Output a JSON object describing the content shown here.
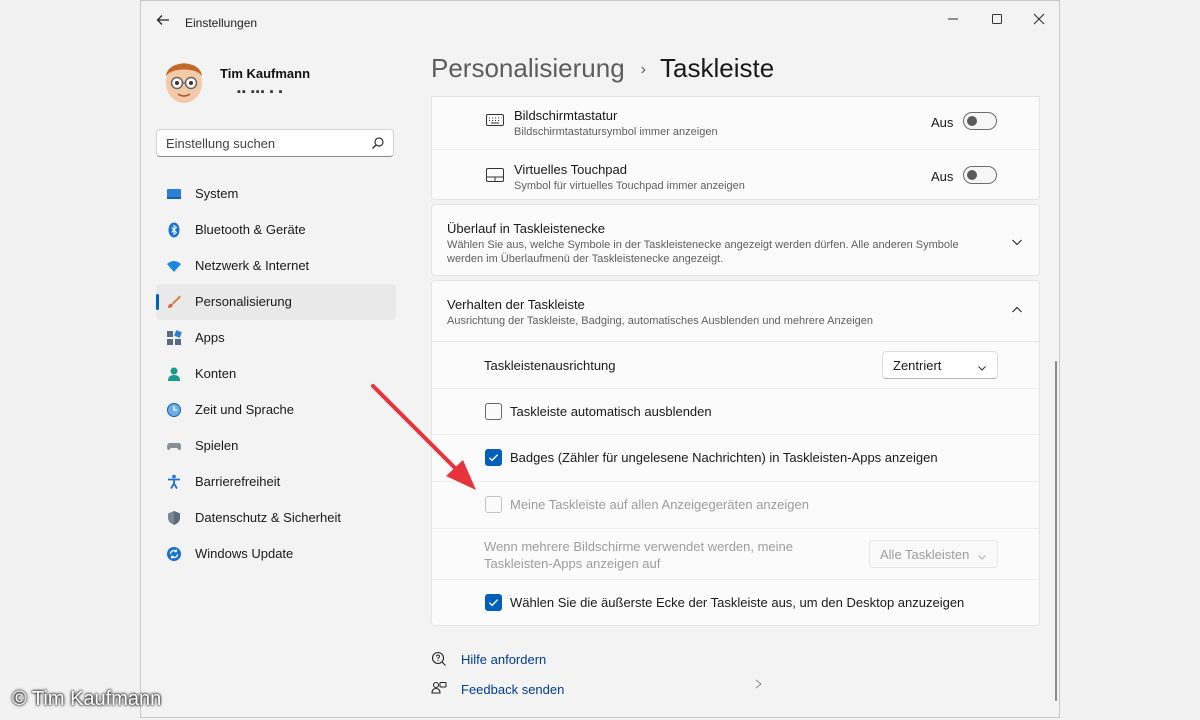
{
  "window": {
    "title": "Einstellungen"
  },
  "profile": {
    "name": "Tim Kaufmann",
    "email_masked": "▪▪ ▪▪▪ ▪ ▪"
  },
  "search": {
    "placeholder": "Einstellung suchen"
  },
  "sidebar": {
    "items": [
      {
        "label": "System",
        "icon": "system-icon"
      },
      {
        "label": "Bluetooth & Geräte",
        "icon": "bluetooth-icon"
      },
      {
        "label": "Netzwerk & Internet",
        "icon": "wifi-icon"
      },
      {
        "label": "Personalisierung",
        "icon": "brush-icon",
        "active": true
      },
      {
        "label": "Apps",
        "icon": "apps-icon"
      },
      {
        "label": "Konten",
        "icon": "person-icon"
      },
      {
        "label": "Zeit und Sprache",
        "icon": "clock-globe-icon"
      },
      {
        "label": "Spielen",
        "icon": "gamepad-icon"
      },
      {
        "label": "Barrierefreiheit",
        "icon": "accessibility-icon"
      },
      {
        "label": "Datenschutz & Sicherheit",
        "icon": "shield-icon"
      },
      {
        "label": "Windows Update",
        "icon": "update-icon"
      }
    ]
  },
  "breadcrumb": {
    "parent": "Personalisierung",
    "separator": "›",
    "current": "Taskleiste"
  },
  "corner_icons": {
    "keyboard": {
      "title": "Bildschirmtastatur",
      "desc": "Bildschirmtastatursymbol immer anzeigen",
      "state": "Aus"
    },
    "touchpad": {
      "title": "Virtuelles Touchpad",
      "desc": "Symbol für virtuelles Touchpad immer anzeigen",
      "state": "Aus"
    }
  },
  "overflow": {
    "title": "Überlauf in Taskleistenecke",
    "desc": "Wählen Sie aus, welche Symbole in der Taskleistenecke angezeigt werden dürfen. Alle anderen Symbole werden im Überlaufmenü der Taskleistenecke angezeigt."
  },
  "behavior": {
    "title": "Verhalten der Taskleiste",
    "desc": "Ausrichtung der Taskleiste, Badging, automatisches Ausblenden und mehrere Anzeigen",
    "alignment": {
      "label": "Taskleistenausrichtung",
      "value": "Zentriert"
    },
    "autohide": {
      "label": "Taskleiste automatisch ausblenden",
      "checked": false
    },
    "badges": {
      "label": "Badges (Zähler für ungelesene Nachrichten) in Taskleisten-Apps anzeigen",
      "checked": true
    },
    "all_displays": {
      "label": "Meine Taskleiste auf allen Anzeigegeräten anzeigen",
      "checked": false,
      "disabled": true
    },
    "multi_monitor": {
      "label": "Wenn mehrere Bildschirme verwendet werden, meine Taskleisten-Apps anzeigen auf",
      "value": "Alle Taskleisten",
      "disabled": true
    },
    "desktop_corner": {
      "label": "Wählen Sie die äußerste Ecke der Taskleiste aus, um den Desktop anzuzeigen",
      "checked": true
    }
  },
  "links": {
    "help": "Hilfe anfordern",
    "feedback": "Feedback senden"
  },
  "copyright": "© Tim Kaufmann",
  "colors": {
    "accent": "#005fb8",
    "arrow": "#e8323c",
    "link": "#003e92"
  }
}
